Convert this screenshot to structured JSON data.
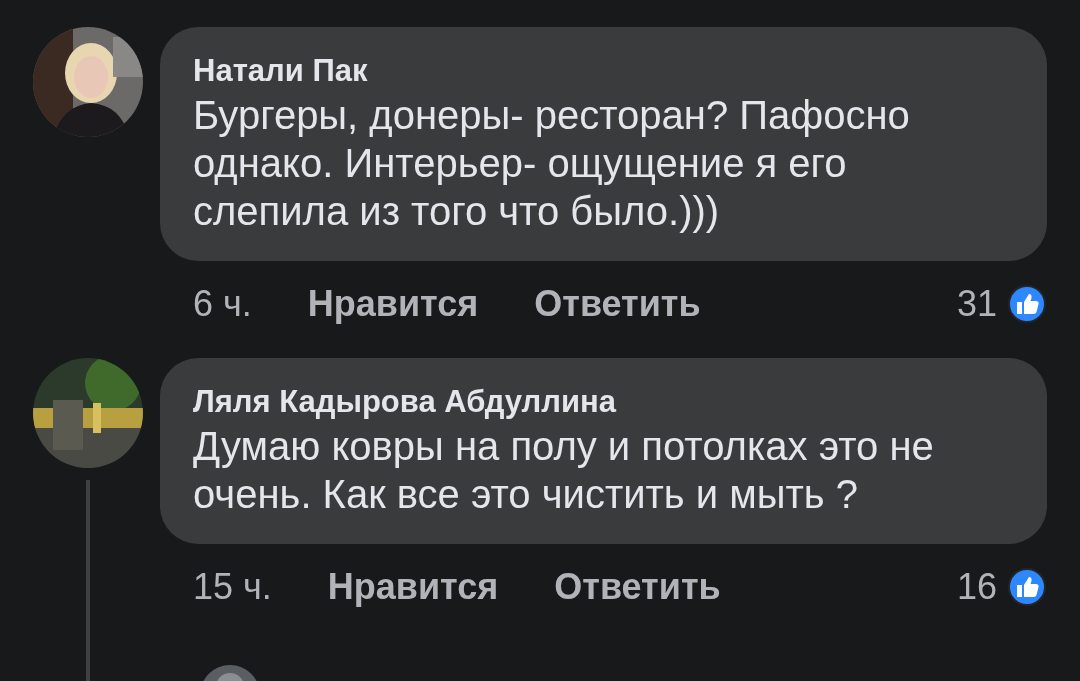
{
  "comments": [
    {
      "author": "Натали Пак",
      "text": "Бургеры, донеры- ресторан? Пафосно однако. Интерьер- ощущение я его слепила из того что было.)))",
      "time": "6 ч.",
      "actions": [
        "Нравится",
        "Ответить"
      ],
      "reaction_count": "31",
      "has_replies": false
    },
    {
      "author": "Ляля Кадырова Абдуллина",
      "text": "Думаю ковры на полу и потолках это не очень. Как все это чистить и мыть ?",
      "time": "15 ч.",
      "actions": [
        "Нравится",
        "Ответить"
      ],
      "reaction_count": "16",
      "has_replies": true
    }
  ]
}
